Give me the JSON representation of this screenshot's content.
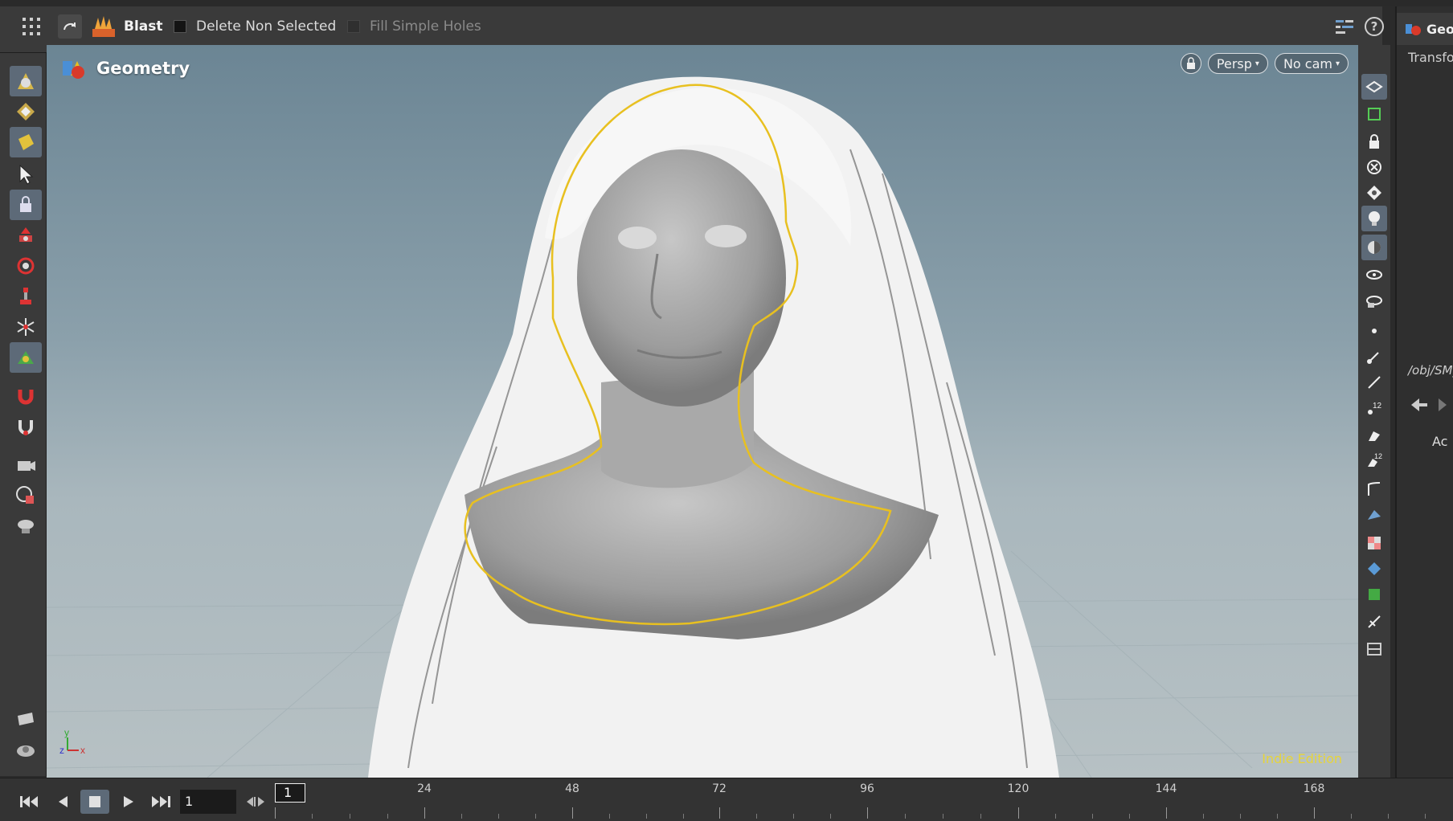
{
  "toolbar": {
    "tool_name": "Blast",
    "delete_non_selected_label": "Delete Non Selected",
    "fill_simple_holes_label": "Fill Simple Holes"
  },
  "viewport": {
    "title": "Geometry",
    "persp_label": "Persp",
    "cam_label": "No cam",
    "edition_label": "Indie Edition",
    "axis_labels": [
      "y",
      "z",
      "x"
    ]
  },
  "right_panel": {
    "tab_label": "Geo",
    "transform_label": "Transfo",
    "path_label": "/obj/SM_",
    "ac_label": "Ac"
  },
  "timeline": {
    "current_frame": "1",
    "frame_field": "1",
    "ticks": [
      "24",
      "48",
      "72",
      "96",
      "120",
      "144",
      "168"
    ]
  },
  "colors": {
    "accent": "#5d6a78",
    "selection_outline": "#e8c020",
    "indie_text": "#e6d43a"
  },
  "icons": {
    "left_toolbar": [
      "select-mode-icon",
      "edit-mode-icon",
      "object-mode-icon",
      "arrow-select-icon",
      "lock-select-icon",
      "move-icon",
      "rotate-icon",
      "scale-icon",
      "handle-icon",
      "pose-icon",
      "magnet-icon",
      "snap-magnet-icon",
      "camera-icon",
      "render-region-icon",
      "light-icon",
      "shelf-icon",
      "cam-settings-icon"
    ],
    "right_toolbar": [
      "display-options-icon",
      "wireframe-icon",
      "lock-icon",
      "ghost-icon",
      "pin-icon",
      "lightbulb-icon",
      "shade-icon",
      "eye-icon",
      "eye-alt-icon",
      "point-icon",
      "brush-icon",
      "pen-icon",
      "number-icon",
      "paint-icon",
      "number-brush-icon",
      "crop-icon",
      "shader-icon",
      "checker-icon",
      "diamond-icon",
      "uv-icon",
      "pointer-icon",
      "dock-icon"
    ]
  }
}
